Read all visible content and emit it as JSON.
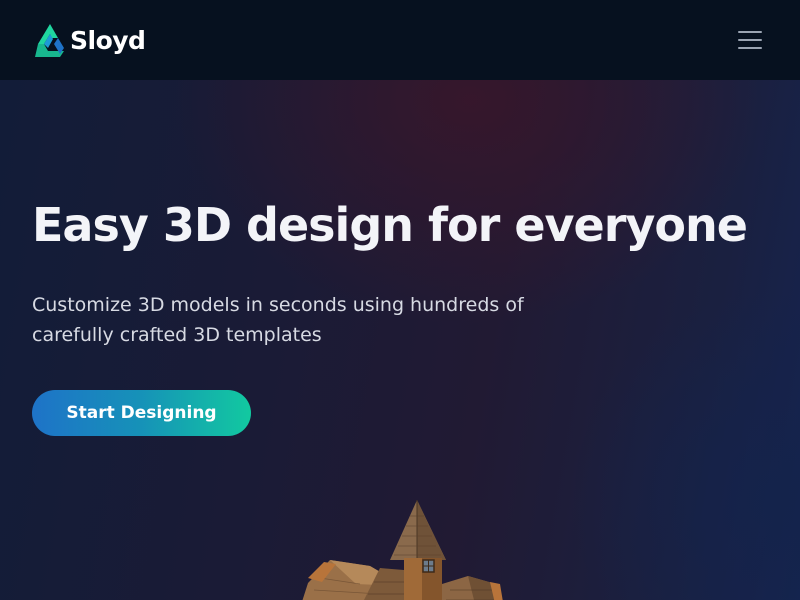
{
  "navbar": {
    "brand": "Sloyd",
    "colors": {
      "logo_green": "#1fd6a0",
      "logo_blue": "#1e73c8"
    },
    "menu_icon": "hamburger-icon"
  },
  "hero": {
    "title": "Easy 3D design for everyone",
    "subtitle": "Customize 3D models in seconds using hundreds of carefully crafted 3D templates",
    "cta_label": "Start Designing",
    "cta_colors": [
      "#1e73c8",
      "#12c9a0"
    ],
    "image": "3d-wooden-house-model"
  }
}
